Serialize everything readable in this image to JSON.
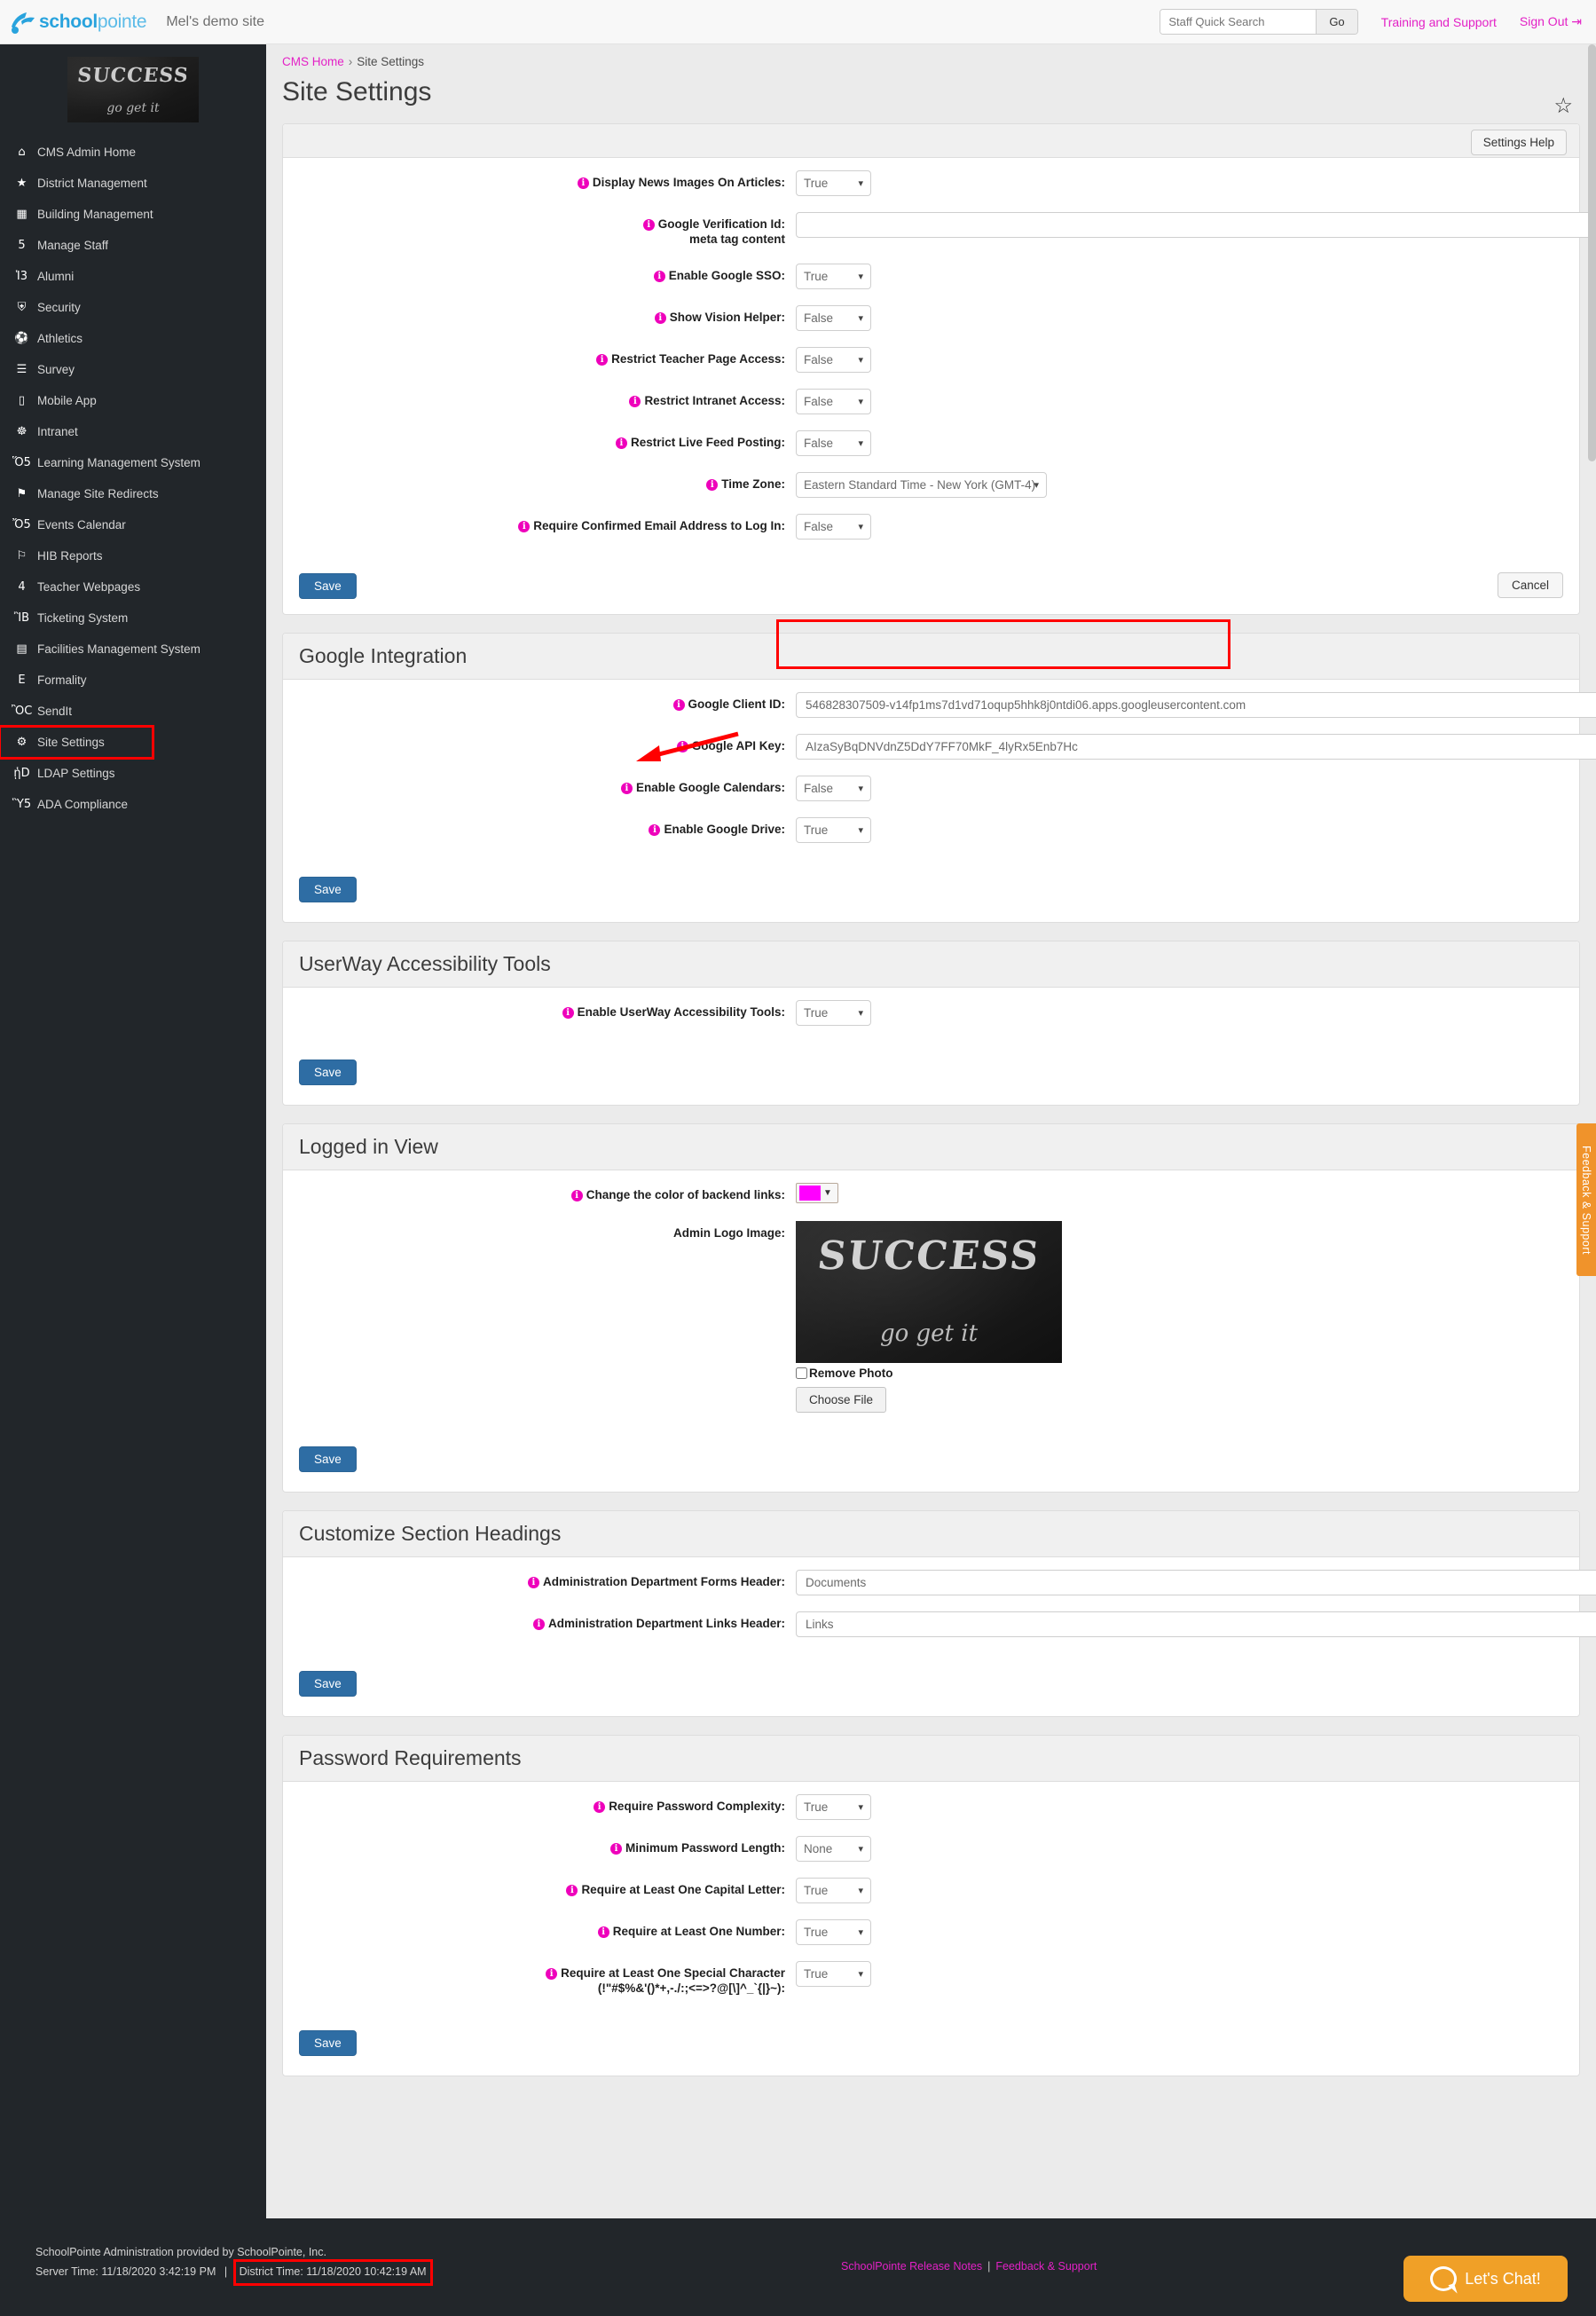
{
  "topbar": {
    "brand_bold": "school",
    "brand_light": "pointe",
    "site_name": "Mel's demo site",
    "search_placeholder": "Staff Quick Search",
    "go_label": "Go",
    "training_link": "Training and Support",
    "signout_link": "Sign Out"
  },
  "sidebar": {
    "logo_line1": "SUCCESS",
    "logo_line2": "go get it",
    "items": [
      {
        "label": "CMS Admin Home",
        "icon": "home-icon",
        "glyph": "⌂"
      },
      {
        "label": "District Management",
        "icon": "star-icon",
        "glyph": "★"
      },
      {
        "label": "Building Management",
        "icon": "building-icon",
        "glyph": "▦"
      },
      {
        "label": "Manage Staff",
        "icon": "users-icon",
        "glyph": "὆5"
      },
      {
        "label": "Alumni",
        "icon": "graduation-cap-icon",
        "glyph": "Ἱ3"
      },
      {
        "label": "Security",
        "icon": "shield-icon",
        "glyph": "⛨"
      },
      {
        "label": "Athletics",
        "icon": "soccer-ball-icon",
        "glyph": "⚽"
      },
      {
        "label": "Survey",
        "icon": "list-icon",
        "glyph": "☰"
      },
      {
        "label": "Mobile App",
        "icon": "mobile-phone-icon",
        "glyph": "▯"
      },
      {
        "label": "Intranet",
        "icon": "sitemap-icon",
        "glyph": "☸"
      },
      {
        "label": "Learning Management System",
        "icon": "book-icon",
        "glyph": "Ὅ5"
      },
      {
        "label": "Manage Site Redirects",
        "icon": "flag-icon",
        "glyph": "⚑"
      },
      {
        "label": "Events Calendar",
        "icon": "calendar-icon",
        "glyph": "Ὄ5"
      },
      {
        "label": "HIB Reports",
        "icon": "flag-outline-icon",
        "glyph": "⚐"
      },
      {
        "label": "Teacher Webpages",
        "icon": "user-icon",
        "glyph": "὆4"
      },
      {
        "label": "Ticketing System",
        "icon": "ticket-icon",
        "glyph": "ἺB"
      },
      {
        "label": "Facilities Management System",
        "icon": "building-list-icon",
        "glyph": "▤"
      },
      {
        "label": "Formality",
        "icon": "file-icon",
        "glyph": "὜E"
      },
      {
        "label": "SendIt",
        "icon": "comment-icon",
        "glyph": "ὊC"
      },
      {
        "label": "Site Settings",
        "icon": "gears-icon",
        "glyph": "⚙",
        "highlighted": true
      },
      {
        "label": "LDAP Settings",
        "icon": "handshake-icon",
        "glyph": "ᾑD"
      },
      {
        "label": "ADA Compliance",
        "icon": "monitor-icon",
        "glyph": "Ὓ5"
      }
    ]
  },
  "breadcrumb": {
    "home": "CMS Home",
    "separator": "›",
    "current": "Site Settings"
  },
  "page_title": "Site Settings",
  "settings_help_label": "Settings Help",
  "general": {
    "rows": [
      {
        "label": "Display News Images On Articles:",
        "type": "select",
        "value": "True"
      },
      {
        "label": "Google Verification Id:",
        "label2": "meta tag content",
        "type": "text",
        "value": ""
      },
      {
        "label": "Enable Google SSO:",
        "type": "select",
        "value": "True"
      },
      {
        "label": "Show Vision Helper:",
        "type": "select",
        "value": "False"
      },
      {
        "label": "Restrict Teacher Page Access:",
        "type": "select",
        "value": "False"
      },
      {
        "label": "Restrict Intranet Access:",
        "type": "select",
        "value": "False"
      },
      {
        "label": "Restrict Live Feed Posting:",
        "type": "select",
        "value": "False"
      },
      {
        "label": "Time Zone:",
        "type": "select-wide",
        "value": "Eastern Standard Time - New York (GMT-4)",
        "highlighted": true
      },
      {
        "label": "Require Confirmed Email Address to Log In:",
        "type": "select",
        "value": "False"
      }
    ],
    "save_label": "Save",
    "cancel_label": "Cancel"
  },
  "google": {
    "heading": "Google Integration",
    "rows": [
      {
        "label": "Google Client ID:",
        "type": "text-kbd",
        "value": "546828307509-v14fp1ms7d1vd71oqup5hhk8j0ntdi06.apps.googleusercontent.com"
      },
      {
        "label": "Google API Key:",
        "type": "text",
        "value": "AIzaSyBqDNVdnZ5DdY7FF70MkF_4lyRx5Enb7Hc"
      },
      {
        "label": "Enable Google Calendars:",
        "type": "select",
        "value": "False"
      },
      {
        "label": "Enable Google Drive:",
        "type": "select",
        "value": "True"
      }
    ],
    "save_label": "Save"
  },
  "userway": {
    "heading": "UserWay Accessibility Tools",
    "rows": [
      {
        "label": "Enable UserWay Accessibility Tools:",
        "type": "select",
        "value": "True"
      }
    ],
    "save_label": "Save"
  },
  "logged_in_view": {
    "heading": "Logged in View",
    "color_label": "Change the color of backend links:",
    "color_value": "#FF00FF",
    "logo_label": "Admin Logo Image:",
    "logo_line1": "SUCCESS",
    "logo_line2": "go get it",
    "remove_photo_label": "Remove Photo",
    "choose_file_label": "Choose File",
    "save_label": "Save"
  },
  "section_headings": {
    "heading": "Customize Section Headings",
    "rows": [
      {
        "label": "Administration Department Forms Header:",
        "type": "text",
        "value": "Documents"
      },
      {
        "label": "Administration Department Links Header:",
        "type": "text",
        "value": "Links"
      }
    ],
    "save_label": "Save"
  },
  "password": {
    "heading": "Password Requirements",
    "rows": [
      {
        "label": "Require Password Complexity:",
        "type": "select",
        "value": "True"
      },
      {
        "label": "Minimum Password Length:",
        "type": "select",
        "value": "None"
      },
      {
        "label": "Require at Least One Capital Letter:",
        "type": "select",
        "value": "True"
      },
      {
        "label": "Require at Least One Number:",
        "type": "select",
        "value": "True"
      },
      {
        "label": "Require at Least One Special Character",
        "label2": "(!\"#$%&'()*+,-./:;<=>?@[\\]^_`{|}~):",
        "type": "select",
        "value": "True"
      }
    ],
    "save_label": "Save"
  },
  "feedback_tab_label": "Feedback & Support",
  "footer": {
    "provided_by": "SchoolPointe Administration provided by SchoolPointe, Inc.",
    "server_time": "Server Time: 11/18/2020 3:42:19 PM",
    "separator": "|",
    "district_time": "District Time: 11/18/2020 10:42:19 AM",
    "release_notes": "SchoolPointe Release Notes",
    "feedback_support": "Feedback & Support",
    "chat_label": "Let's Chat!"
  }
}
